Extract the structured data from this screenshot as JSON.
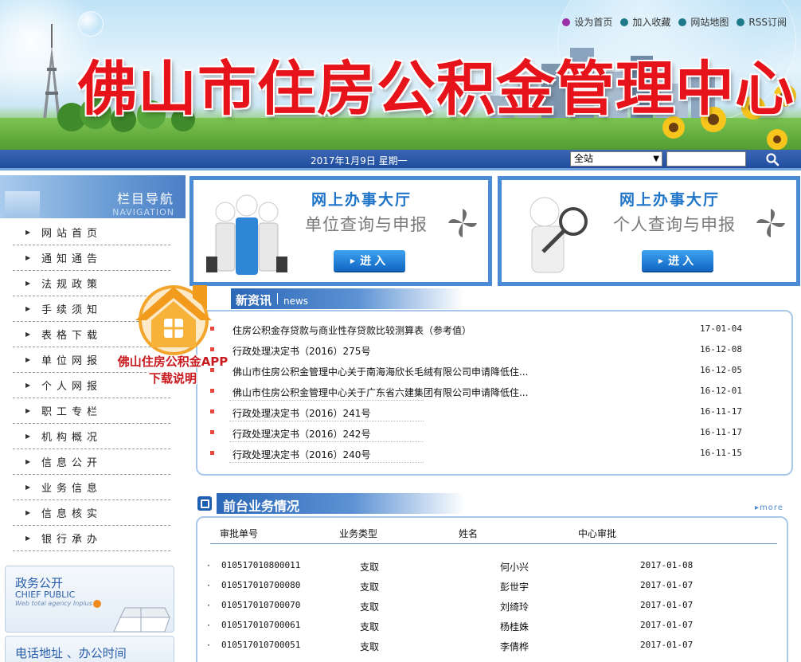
{
  "banner": {
    "site_title": "佛山市住房公积金管理中心",
    "top_links": [
      {
        "label": "设为首页",
        "color": "#9b2fa8"
      },
      {
        "label": "加入收藏",
        "color": "#1e7a8a"
      },
      {
        "label": "网站地图",
        "color": "#1e7a8a"
      },
      {
        "label": "RSS订阅",
        "color": "#1e7a8a"
      }
    ]
  },
  "datebar": {
    "date": "2017年1月9日 星期一",
    "site_select": "全站",
    "search_value": ""
  },
  "nav": {
    "title": "栏目导航",
    "subtitle": "NAVIGATION",
    "items": [
      "网站首页",
      "通知通告",
      "法规政策",
      "手续须知",
      "表格下载",
      "单位网报",
      "个人网报",
      "职工专栏",
      "机构概况",
      "信息公开",
      "业务信息",
      "信息核实",
      "银行承办"
    ]
  },
  "app_ad": {
    "line1": "佛山住房公积金APP",
    "line2": "下载说明"
  },
  "halls": [
    {
      "title": "网上办事大厅",
      "subtitle": "单位查询与申报",
      "button": "进入"
    },
    {
      "title": "网上办事大厅",
      "subtitle": "个人查询与申报",
      "button": "进入"
    }
  ],
  "news": {
    "title": "新资讯",
    "title_en": "news",
    "items": [
      {
        "title": "住房公积金存贷款与商业性存贷款比较测算表（参考值）",
        "date": "17-01-04"
      },
      {
        "title": "行政处理决定书（2016）275号",
        "date": "16-12-08"
      },
      {
        "title": "佛山市住房公积金管理中心关于南海海欣长毛绒有限公司申请降低住...",
        "date": "16-12-05"
      },
      {
        "title": "佛山市住房公积金管理中心关于广东省六建集团有限公司申请降低住...",
        "date": "16-12-01"
      },
      {
        "title": "行政处理决定书（2016）241号",
        "date": "16-11-17"
      },
      {
        "title": "行政处理决定书（2016）242号",
        "date": "16-11-17"
      },
      {
        "title": "行政处理决定书（2016）240号",
        "date": "16-11-15"
      }
    ]
  },
  "business": {
    "title": "前台业务情况",
    "more": "more",
    "headers": [
      "审批单号",
      "业务类型",
      "姓名",
      "中心审批"
    ],
    "rows": [
      {
        "id": "010517010800011",
        "type": "支取",
        "name": "何小兴",
        "date": "2017-01-08"
      },
      {
        "id": "010517010700080",
        "type": "支取",
        "name": "彭世宇",
        "date": "2017-01-07"
      },
      {
        "id": "010517010700070",
        "type": "支取",
        "name": "刘绮玲",
        "date": "2017-01-07"
      },
      {
        "id": "010517010700061",
        "type": "支取",
        "name": "杨桂姝",
        "date": "2017-01-07"
      },
      {
        "id": "010517010700051",
        "type": "支取",
        "name": "李倩桦",
        "date": "2017-01-07"
      }
    ]
  },
  "gov_public": {
    "title": "政务公开",
    "title_en": "CHIEF PUBLIC",
    "subtitle": "Web total agency Inplus"
  },
  "contact": {
    "title": "电话地址 、办公时间"
  }
}
